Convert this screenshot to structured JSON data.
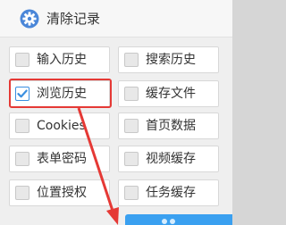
{
  "dialog": {
    "title": "清除记录",
    "icon": "gear-icon"
  },
  "options": [
    {
      "label": "输入历史",
      "checked": false
    },
    {
      "label": "搜索历史",
      "checked": false
    },
    {
      "label": "浏览历史",
      "checked": true
    },
    {
      "label": "缓存文件",
      "checked": false
    },
    {
      "label": "Cookies",
      "checked": false
    },
    {
      "label": "首页数据",
      "checked": false
    },
    {
      "label": "表单密码",
      "checked": false
    },
    {
      "label": "视频缓存",
      "checked": false
    },
    {
      "label": "位置授权",
      "checked": false
    },
    {
      "label": "任务缓存",
      "checked": false
    }
  ],
  "annotation": {
    "highlight_color": "#e53935",
    "arrow_color": "#e53935"
  },
  "colors": {
    "accent": "#3a8fe0",
    "confirm": "#3aa0f0"
  }
}
